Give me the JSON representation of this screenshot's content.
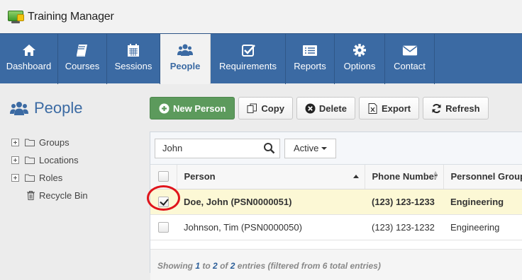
{
  "app": {
    "title": "Training Manager"
  },
  "nav": {
    "items": [
      {
        "label": "Dashboard",
        "icon": "home-icon"
      },
      {
        "label": "Courses",
        "icon": "book-icon"
      },
      {
        "label": "Sessions",
        "icon": "calendar-icon"
      },
      {
        "label": "People",
        "icon": "users-icon",
        "active": true
      },
      {
        "label": "Requirements",
        "icon": "checkbox-icon"
      },
      {
        "label": "Reports",
        "icon": "list-icon"
      },
      {
        "label": "Options",
        "icon": "gear-icon"
      },
      {
        "label": "Contact",
        "icon": "envelope-icon"
      }
    ]
  },
  "sidebar": {
    "title": "People",
    "tree": [
      {
        "label": "Groups",
        "icon": "folder-icon"
      },
      {
        "label": "Locations",
        "icon": "folder-icon"
      },
      {
        "label": "Roles",
        "icon": "folder-icon"
      },
      {
        "label": "Recycle Bin",
        "icon": "trash-icon"
      }
    ]
  },
  "toolbar": {
    "new_person": "New Person",
    "copy": "Copy",
    "delete": "Delete",
    "export": "Export",
    "refresh": "Refresh"
  },
  "filter": {
    "search_value": "John",
    "status": "Active"
  },
  "table": {
    "columns": [
      "Person",
      "Phone Number",
      "Personnel Group"
    ],
    "rows": [
      {
        "person": "Doe, John (PSN0000051)",
        "phone": "(123) 123-1233",
        "group": "Engineering",
        "checked": true
      },
      {
        "person": "Johnson, Tim (PSN0000050)",
        "phone": "(123) 123-1232",
        "group": "Engineering",
        "checked": false
      }
    ],
    "info": {
      "prefix": "Showing",
      "start": "1",
      "to": "to",
      "end": "2",
      "of": "of",
      "total": "2",
      "suffix": "entries (filtered from 6 total entries)"
    }
  },
  "colors": {
    "navbar": "#3b6aa3",
    "primary_button": "#5c9a5c",
    "selected_row": "#fcf8d5",
    "highlight": "#e0141b"
  }
}
